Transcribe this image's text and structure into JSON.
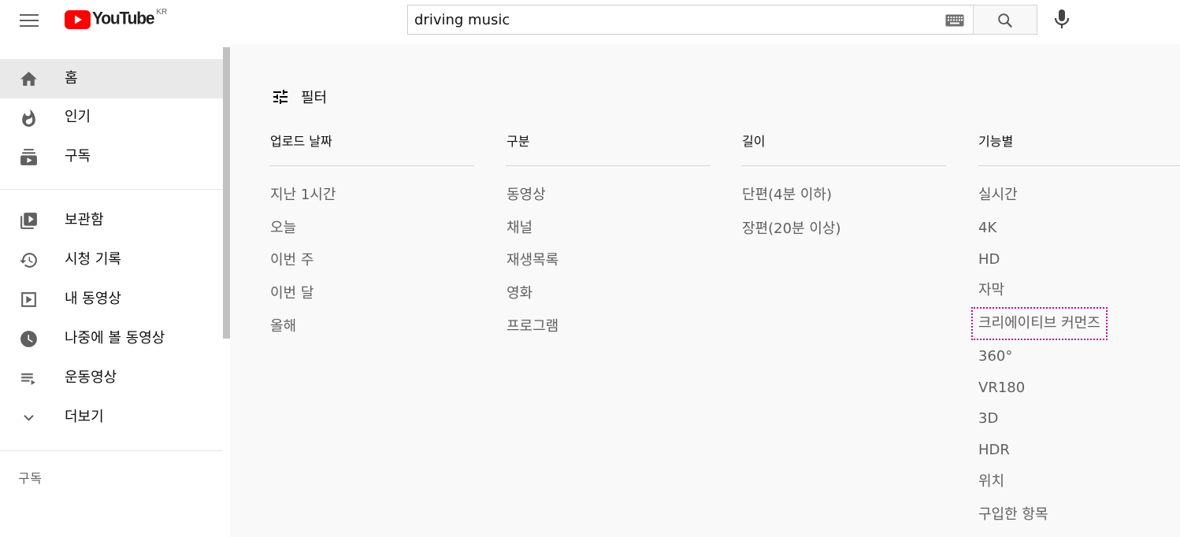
{
  "header": {
    "logo_text": "YouTube",
    "country_code": "KR",
    "search_value": "driving music",
    "brand_color": "#ff0000"
  },
  "sidebar": {
    "primary": [
      {
        "label": "홈",
        "icon": "home-icon",
        "active": true
      },
      {
        "label": "인기",
        "icon": "trending-flame-icon"
      },
      {
        "label": "구독",
        "icon": "subscriptions-icon"
      }
    ],
    "library": [
      {
        "label": "보관함",
        "icon": "library-icon"
      },
      {
        "label": "시청 기록",
        "icon": "history-icon"
      },
      {
        "label": "내 동영상",
        "icon": "your-videos-icon"
      },
      {
        "label": "나중에 볼 동영상",
        "icon": "watch-later-icon"
      },
      {
        "label": "운동영상",
        "icon": "playlist-icon"
      },
      {
        "label": "더보기",
        "icon": "chevron-down-icon"
      }
    ],
    "section_title": "구독"
  },
  "filters": {
    "toggle_label": "필터",
    "columns": [
      {
        "title": "업로드 날짜",
        "options": [
          "지난 1시간",
          "오늘",
          "이번 주",
          "이번 달",
          "올해"
        ]
      },
      {
        "title": "구분",
        "options": [
          "동영상",
          "채널",
          "재생목록",
          "영화",
          "프로그램"
        ]
      },
      {
        "title": "길이",
        "options": [
          "단편(4분 이하)",
          "장편(20분 이상)"
        ]
      },
      {
        "title": "기능별",
        "options": [
          "실시간",
          "4K",
          "HD",
          "자막",
          "크리에이티브 커먼즈",
          "360°",
          "VR180",
          "3D",
          "HDR",
          "위치",
          "구입한 항목"
        ]
      }
    ],
    "highlighted_option": "크리에이티브 커먼즈",
    "highlight_color": "#c40aa0"
  }
}
